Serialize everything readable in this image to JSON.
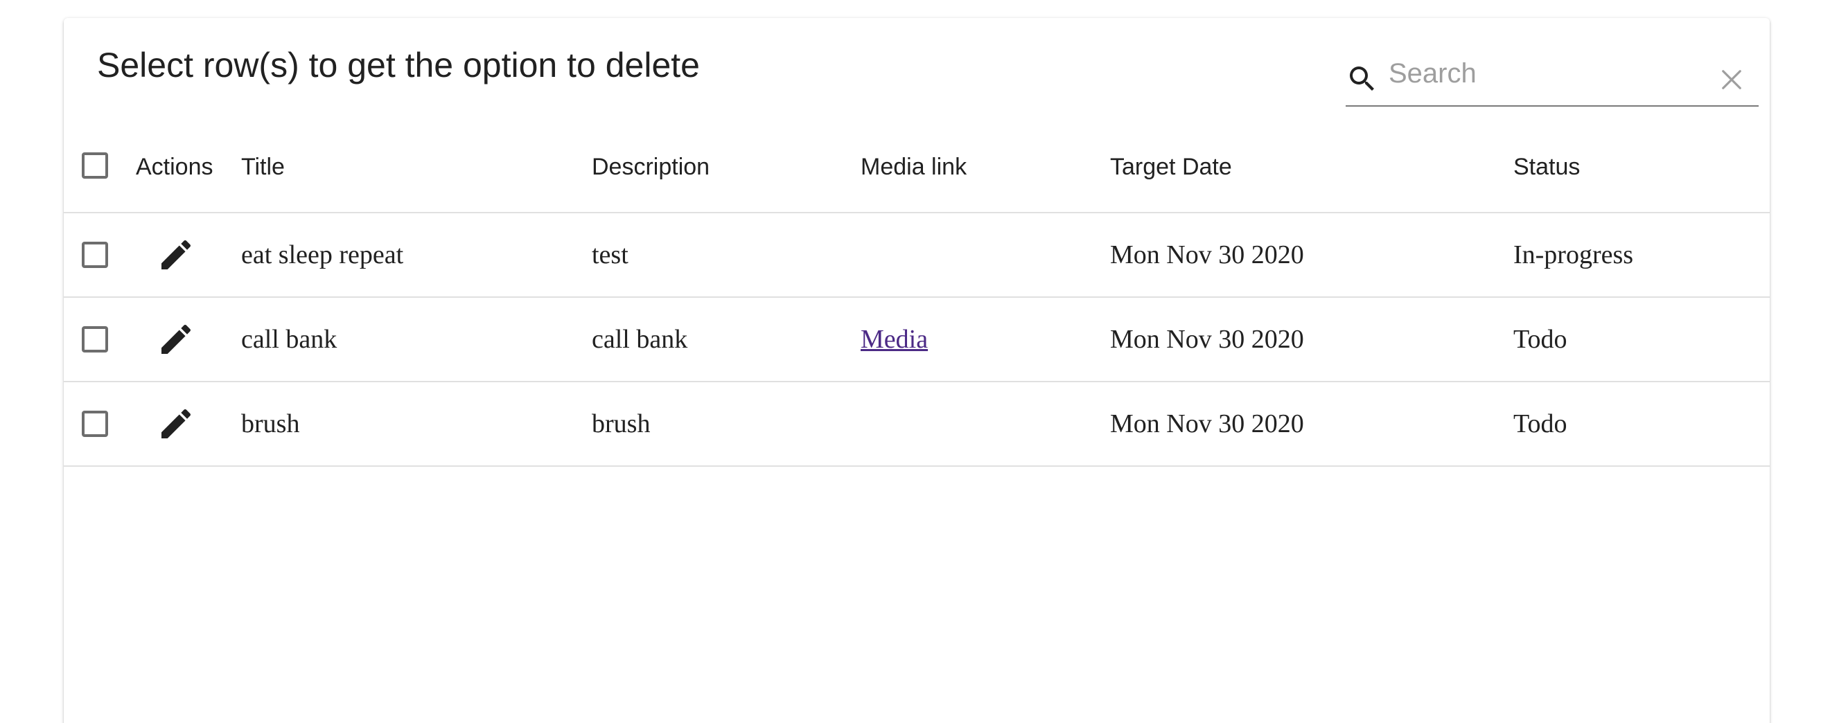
{
  "toolbar": {
    "title": "Select row(s) to get the option to delete",
    "search": {
      "placeholder": "Search",
      "value": ""
    },
    "icons": {
      "search": "search-icon",
      "clear": "close-icon"
    }
  },
  "table": {
    "columns": {
      "actions": "Actions",
      "title": "Title",
      "description": "Description",
      "media_link": "Media link",
      "target_date": "Target Date",
      "status": "Status"
    },
    "rows": [
      {
        "title": "eat sleep repeat",
        "description": "test",
        "media_link": "",
        "target_date": "Mon Nov 30 2020",
        "status": "In-progress",
        "selected": false
      },
      {
        "title": "call bank",
        "description": "call bank",
        "media_link": "Media",
        "target_date": "Mon Nov 30 2020",
        "status": "Todo",
        "selected": false
      },
      {
        "title": "brush",
        "description": "brush",
        "media_link": "",
        "target_date": "Mon Nov 30 2020",
        "status": "Todo",
        "selected": false
      }
    ],
    "row_action_icon": "pencil-edit-icon"
  },
  "colors": {
    "link": "#4c2a86",
    "divider": "#e0e0e0",
    "text": "#212121",
    "muted": "#9e9e9e"
  }
}
